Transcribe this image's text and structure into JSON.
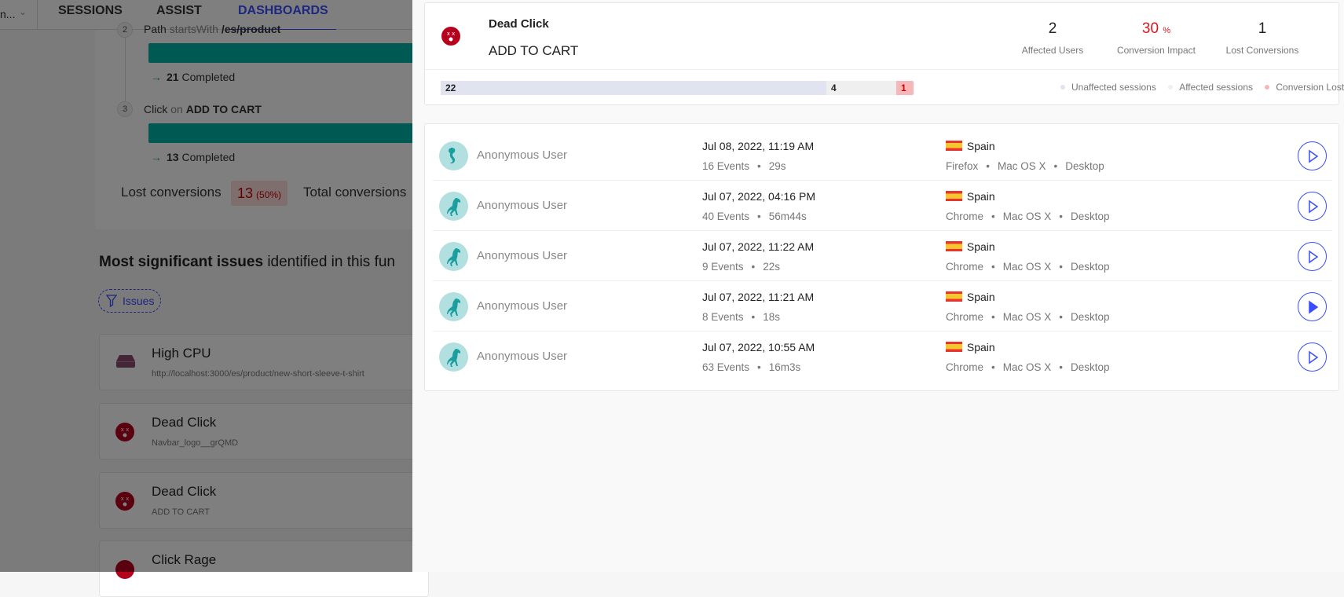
{
  "header": {
    "project": "n...",
    "tabs": [
      {
        "label": "SESSIONS"
      },
      {
        "label": "ASSIST"
      },
      {
        "label": "DASHBOARDS",
        "active": true
      }
    ]
  },
  "funnel": {
    "steps": [
      {
        "num": "2",
        "type": "Path",
        "op": "startsWith",
        "value": "/es/product",
        "completed": "21",
        "completed_label": "Completed"
      },
      {
        "num": "3",
        "type": "Click",
        "op": "on",
        "value": "ADD TO CART",
        "completed": "13",
        "completed_label": "Completed"
      }
    ],
    "lost_label": "Lost conversions",
    "lost_value": "13",
    "lost_pct": "(50%)",
    "total_label": "Total conversions"
  },
  "issues_section": {
    "title_bold": "Most significant issues",
    "title_rest": " identified in this fun",
    "filter_label": "Issues",
    "items": [
      {
        "title": "High CPU",
        "subtitle": "http://localhost:3000/es/product/new-short-sleeve-t-shirt",
        "icon": "cpu-icon"
      },
      {
        "title": "Dead Click",
        "subtitle": "Navbar_logo__grQMD",
        "icon": "dead-click-icon"
      },
      {
        "title": "Dead Click",
        "subtitle": "ADD TO CART",
        "icon": "dead-click-icon"
      },
      {
        "title": "Click Rage",
        "subtitle": "",
        "icon": "click-rage-icon"
      }
    ]
  },
  "detail": {
    "title": "Dead Click",
    "subtitle": "ADD TO CART",
    "metrics": [
      {
        "value": "2",
        "label": "Affected Users"
      },
      {
        "value": "30",
        "unit": "%",
        "label": "Conversion Impact"
      },
      {
        "value": "1",
        "label": "Lost Conversions"
      }
    ],
    "session_bar": [
      {
        "value": "22",
        "color": "#e1e3f0"
      },
      {
        "value": "4",
        "color": "#efefef"
      },
      {
        "value": "1",
        "color": "#f6b7b9"
      }
    ],
    "legend": [
      {
        "label": "Unaffected sessions",
        "color": "#e1e3f0"
      },
      {
        "label": "Affected sessions",
        "color": "#efefef"
      },
      {
        "label": "Conversion Lost",
        "color": "#f6b7b9"
      }
    ],
    "accent": "#394eff"
  },
  "sessions": [
    {
      "user": "Anonymous User",
      "avatar": "seahorse-icon",
      "date": "Jul 08, 2022, 11:19 AM",
      "events": "16 Events",
      "duration": "29s",
      "country": "Spain",
      "browser": "Firefox",
      "os": "Mac OS X",
      "device": "Desktop",
      "played": false
    },
    {
      "user": "Anonymous User",
      "avatar": "horse-icon",
      "date": "Jul 07, 2022, 04:16 PM",
      "events": "40 Events",
      "duration": "56m44s",
      "country": "Spain",
      "browser": "Chrome",
      "os": "Mac OS X",
      "device": "Desktop",
      "played": false
    },
    {
      "user": "Anonymous User",
      "avatar": "horse-icon",
      "date": "Jul 07, 2022, 11:22 AM",
      "events": "9 Events",
      "duration": "22s",
      "country": "Spain",
      "browser": "Chrome",
      "os": "Mac OS X",
      "device": "Desktop",
      "played": false
    },
    {
      "user": "Anonymous User",
      "avatar": "horse-icon",
      "date": "Jul 07, 2022, 11:21 AM",
      "events": "8 Events",
      "duration": "18s",
      "country": "Spain",
      "browser": "Chrome",
      "os": "Mac OS X",
      "device": "Desktop",
      "played": true
    },
    {
      "user": "Anonymous User",
      "avatar": "horse-icon",
      "date": "Jul 07, 2022, 10:55 AM",
      "events": "63 Events",
      "duration": "16m3s",
      "country": "Spain",
      "browser": "Chrome",
      "os": "Mac OS X",
      "device": "Desktop",
      "played": false
    }
  ]
}
